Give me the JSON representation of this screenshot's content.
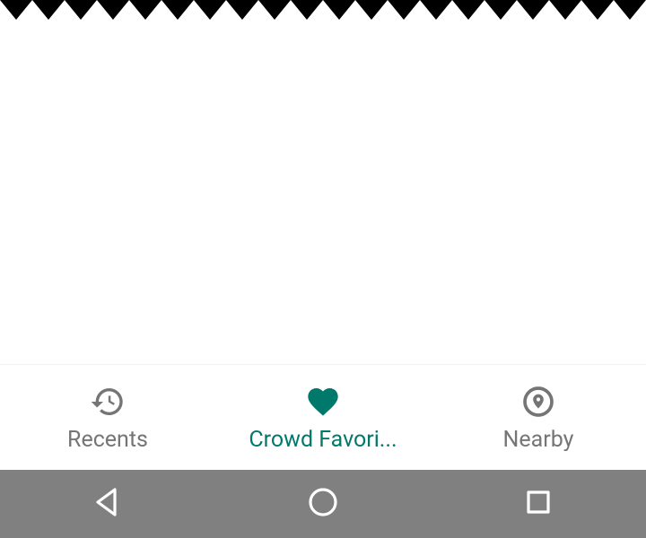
{
  "colors": {
    "accent": "#00796b",
    "inactive": "#757575",
    "sysnavBg": "#808080"
  },
  "bottomNav": {
    "items": [
      {
        "label": "Recents",
        "icon": "history-icon",
        "active": false
      },
      {
        "label": "Crowd Favori...",
        "icon": "heart-icon",
        "active": true
      },
      {
        "label": "Nearby",
        "icon": "place-icon",
        "active": false
      }
    ]
  },
  "sysNav": {
    "buttons": [
      {
        "name": "back"
      },
      {
        "name": "home"
      },
      {
        "name": "overview"
      }
    ]
  }
}
